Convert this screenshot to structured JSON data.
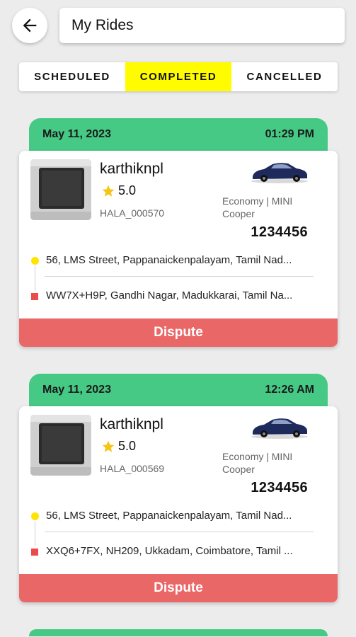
{
  "header": {
    "title": "My Rides",
    "back_icon": "arrow-left-icon"
  },
  "tabs": [
    {
      "label": "SCHEDULED",
      "active": false
    },
    {
      "label": "COMPLETED",
      "active": true
    },
    {
      "label": "CANCELLED",
      "active": false
    }
  ],
  "colors": {
    "accent_yellow": "#fffc00",
    "date_bar_green": "#46c985",
    "dispute_red": "#e96767",
    "drop_marker_red": "#ec4b4b",
    "pickup_marker_yellow": "#ffe400"
  },
  "rides": [
    {
      "date": "May 11, 2023",
      "time": "01:29 PM",
      "driver_name": "karthiknpl",
      "rating": "5.0",
      "ride_id": "HALA_000570",
      "vehicle_type": "Economy  | MINI Cooper",
      "vehicle_number": "1234456",
      "pickup": "56, LMS Street, Pappanaickenpalayam, Tamil Nad...",
      "drop": "WW7X+H9P, Gandhi Nagar, Madukkarai, Tamil Na...",
      "action": "Dispute"
    },
    {
      "date": "May 11, 2023",
      "time": "12:26 AM",
      "driver_name": "karthiknpl",
      "rating": "5.0",
      "ride_id": "HALA_000569",
      "vehicle_type": "Economy  | MINI Cooper",
      "vehicle_number": "1234456",
      "pickup": "56, LMS Street, Pappanaickenpalayam, Tamil Nad...",
      "drop": "XXQ6+7FX, NH209, Ukkadam, Coimbatore, Tamil ...",
      "action": "Dispute"
    }
  ]
}
